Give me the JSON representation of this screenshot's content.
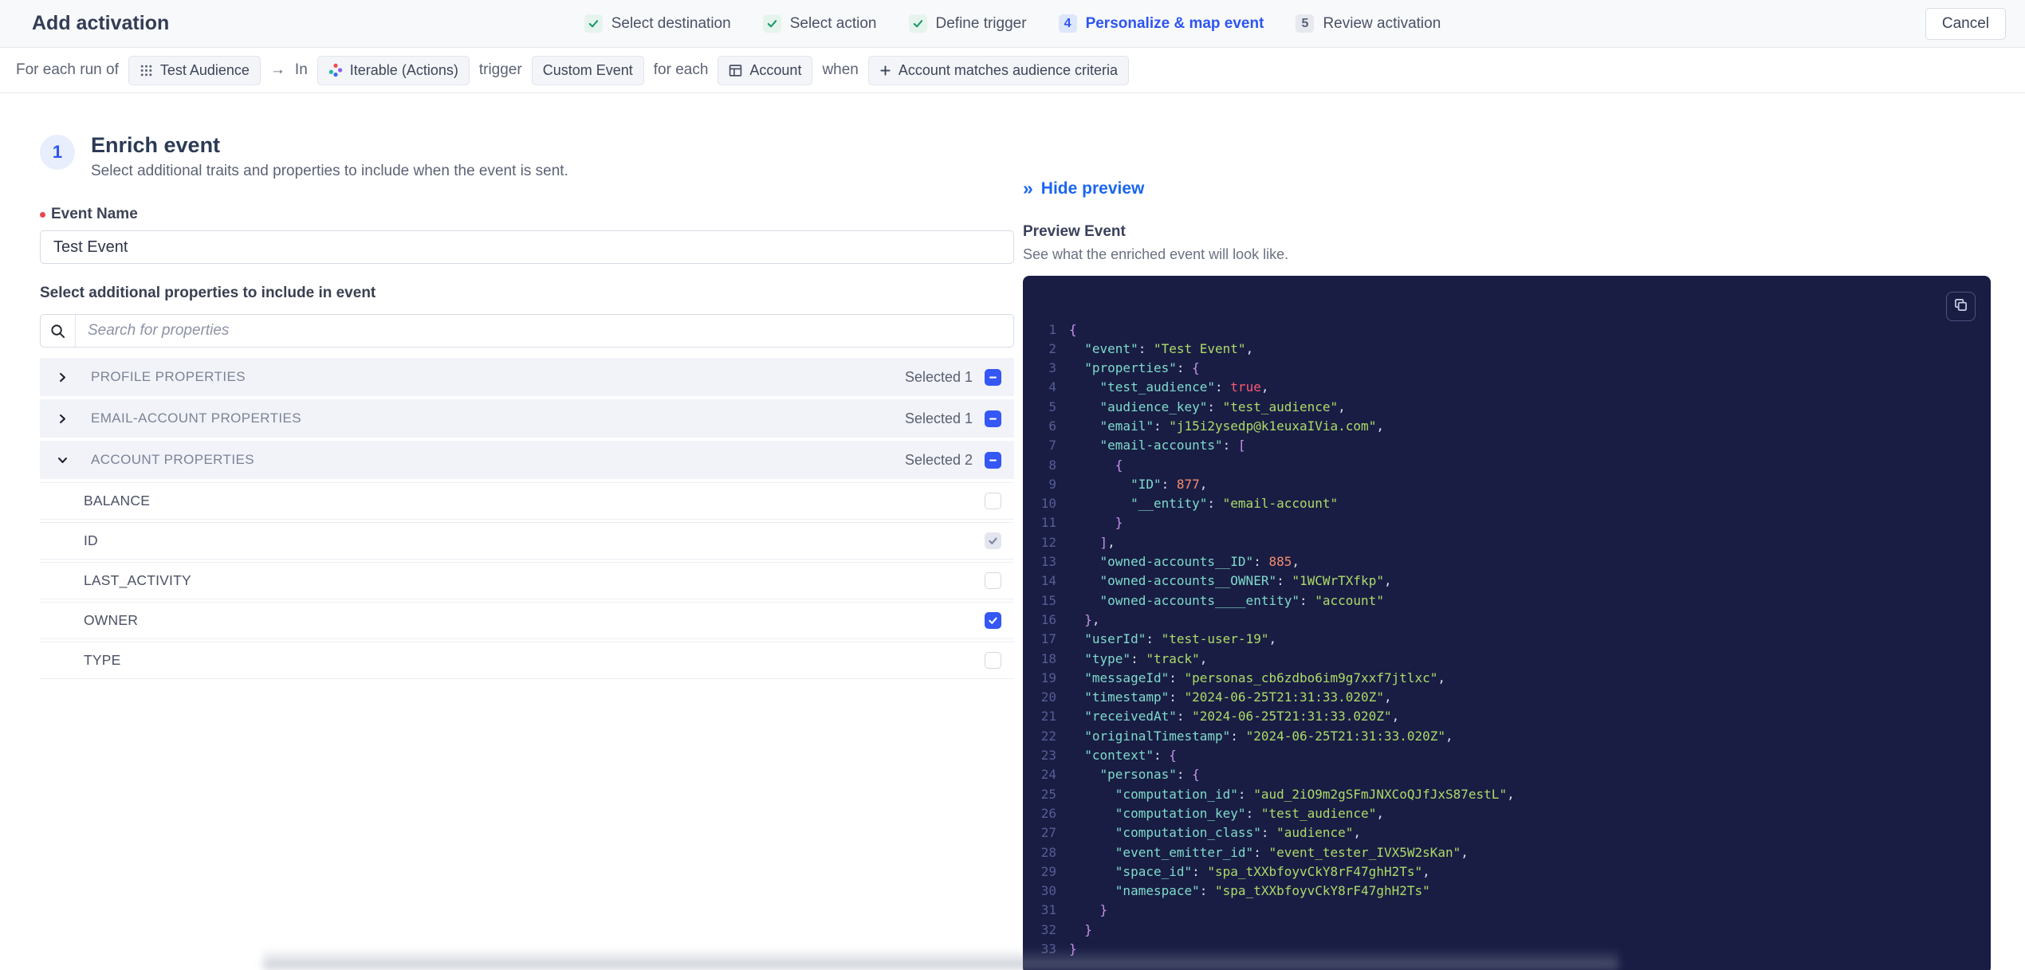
{
  "header": {
    "title": "Add activation",
    "cancel_label": "Cancel",
    "steps": [
      {
        "label": "Select destination",
        "state": "done"
      },
      {
        "label": "Select action",
        "state": "done"
      },
      {
        "label": "Define trigger",
        "state": "done"
      },
      {
        "label": "Personalize & map event",
        "state": "active",
        "number": "4"
      },
      {
        "label": "Review activation",
        "state": "upcoming",
        "number": "5"
      }
    ]
  },
  "context_bar": {
    "segments": [
      {
        "type": "text",
        "text": "For each run of"
      },
      {
        "type": "chip",
        "icon": "audience-icon",
        "label": "Test Audience"
      },
      {
        "type": "text",
        "text": "→"
      },
      {
        "type": "text",
        "text": "In"
      },
      {
        "type": "chip",
        "icon": "iterable-logo-icon",
        "label": "Iterable (Actions)"
      },
      {
        "type": "text",
        "text": "trigger"
      },
      {
        "type": "chip",
        "label": "Custom Event"
      },
      {
        "type": "text",
        "text": "for each"
      },
      {
        "type": "chip",
        "icon": "table-icon",
        "label": "Account"
      },
      {
        "type": "text",
        "text": "when"
      },
      {
        "type": "chip",
        "icon": "plus-icon",
        "label": "Account matches audience criteria"
      }
    ]
  },
  "enrich": {
    "step_number": "1",
    "title": "Enrich event",
    "subtitle": "Select additional traits and properties to include when the event is sent.",
    "event_name_label": "Event Name",
    "event_name_value": "Test Event",
    "properties_label": "Select additional properties to include in event",
    "search_placeholder": "Search for properties",
    "groups": [
      {
        "label": "PROFILE PROPERTIES",
        "selected_text": "Selected 1",
        "expanded": false,
        "items": []
      },
      {
        "label": "EMAIL-ACCOUNT PROPERTIES",
        "selected_text": "Selected 1",
        "expanded": false,
        "items": []
      },
      {
        "label": "ACCOUNT PROPERTIES",
        "selected_text": "Selected 2",
        "expanded": true,
        "items": [
          {
            "label": "BALANCE",
            "state": "unchecked"
          },
          {
            "label": "ID",
            "state": "checked-disabled"
          },
          {
            "label": "LAST_ACTIVITY",
            "state": "unchecked"
          },
          {
            "label": "OWNER",
            "state": "checked"
          },
          {
            "label": "TYPE",
            "state": "unchecked"
          }
        ]
      }
    ]
  },
  "preview": {
    "hide_label": "Hide preview",
    "title": "Preview Event",
    "subtitle": "See what the enriched event will look like.",
    "code_lines": [
      "{",
      "  \"event\": \"Test Event\",",
      "  \"properties\": {",
      "    \"test_audience\": true,",
      "    \"audience_key\": \"test_audience\",",
      "    \"email\": \"j15i2ysedp@k1euxaIVia.com\",",
      "    \"email-accounts\": [",
      "      {",
      "        \"ID\": 877,",
      "        \"__entity\": \"email-account\"",
      "      }",
      "    ],",
      "    \"owned-accounts__ID\": 885,",
      "    \"owned-accounts__OWNER\": \"1WCWrTXfkp\",",
      "    \"owned-accounts____entity\": \"account\"",
      "  },",
      "  \"userId\": \"test-user-19\",",
      "  \"type\": \"track\",",
      "  \"messageId\": \"personas_cb6zdbo6im9g7xxf7jtlxc\",",
      "  \"timestamp\": \"2024-06-25T21:31:33.020Z\",",
      "  \"receivedAt\": \"2024-06-25T21:31:33.020Z\",",
      "  \"originalTimestamp\": \"2024-06-25T21:31:33.020Z\",",
      "  \"context\": {",
      "    \"personas\": {",
      "      \"computation_id\": \"aud_2iO9m2gSFmJNXCoQJfJxS87estL\",",
      "      \"computation_key\": \"test_audience\",",
      "      \"computation_class\": \"audience\",",
      "      \"event_emitter_id\": \"event_tester_IVX5W2sKan\",",
      "      \"space_id\": \"spa_tXXbfoyvCkY8rF47ghH2Ts\",",
      "      \"namespace\": \"spa_tXXbfoyvCkY8rF47ghH2Ts\"",
      "    }",
      "  }",
      "}"
    ]
  },
  "icons": {
    "step_done": "check-icon",
    "audience_chip": "audience-icon",
    "iterable_chip": "iterable-logo-icon",
    "account_chip": "table-icon",
    "criteria_chip": "plus-icon",
    "search": "search-icon",
    "group_collapsed": "chevron-right-icon",
    "group_expanded": "chevron-down-icon",
    "hide_preview": "double-chevron-right-icon",
    "copy": "copy-icon"
  },
  "colors": {
    "accent_blue": "#2d55f0",
    "checkbox_blue": "#3457f5",
    "link_blue": "#1b66f0",
    "success_green": "#17996b",
    "code_bg": "#191d44",
    "code_key": "#7fdbca",
    "code_string": "#addb67",
    "code_number": "#f78c6c",
    "code_bool": "#ff5874",
    "code_brace": "#c792ea",
    "code_default": "#d6deeb",
    "code_line_number": "#565d94"
  }
}
